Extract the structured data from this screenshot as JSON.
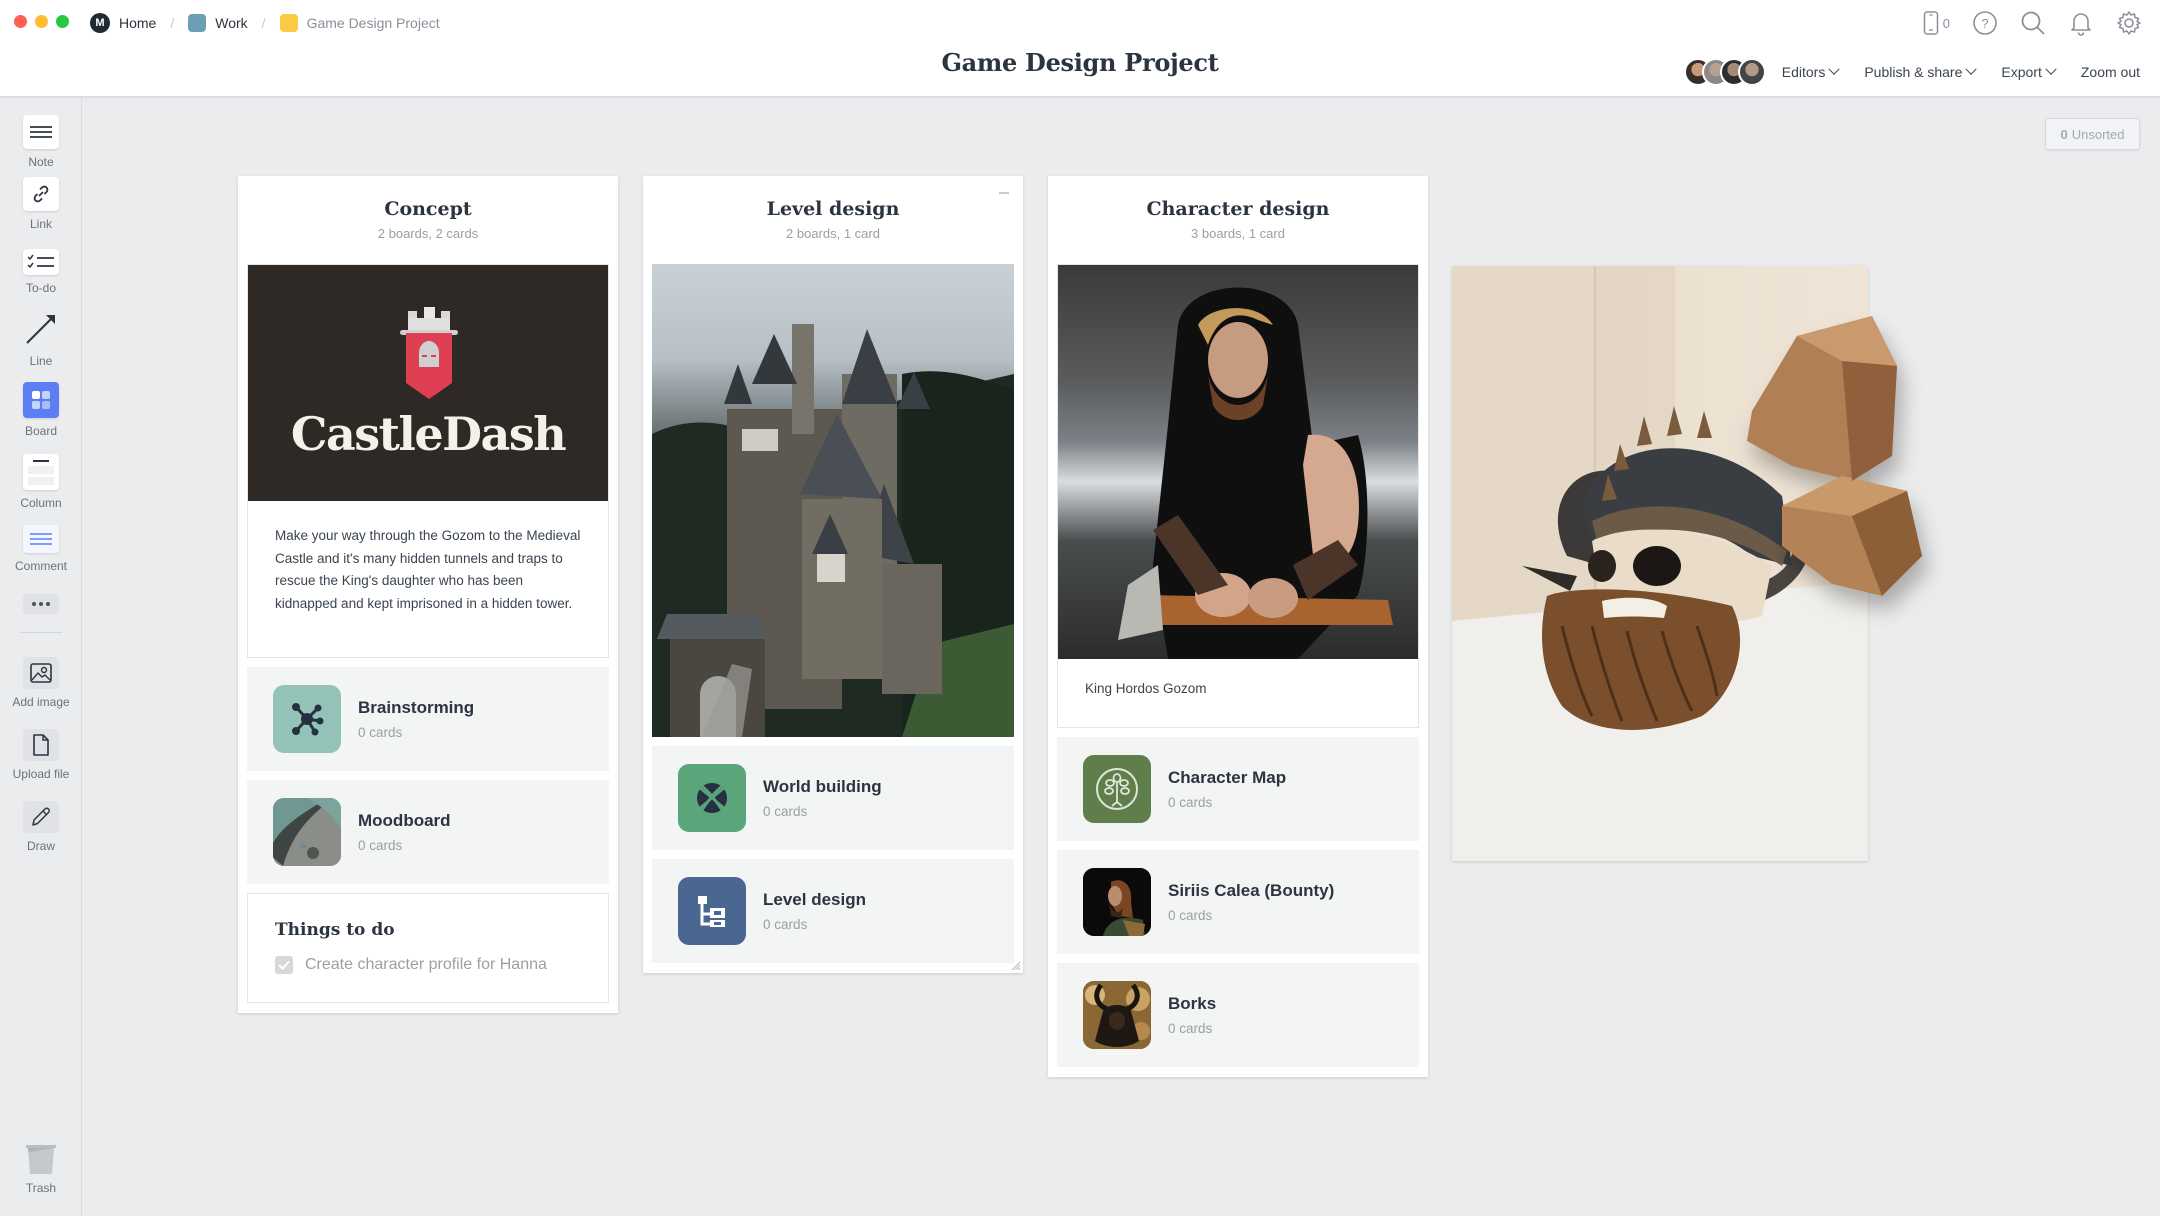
{
  "window": {
    "traffic_lights": {
      "close": "#fe5f57",
      "minimize": "#febc2e",
      "maximize": "#28c840"
    }
  },
  "breadcrumb": [
    {
      "label": "Home",
      "icon": "milanote-logo-icon",
      "color": "#1f2a33"
    },
    {
      "label": "Work",
      "icon": "board-color-icon",
      "color": "#6a9fb5"
    },
    {
      "label": "Game Design Project",
      "icon": "board-color-icon",
      "color": "#fbc944"
    }
  ],
  "header": {
    "title": "Game Design Project",
    "device_count": "0",
    "icons": [
      "mobile-device-icon",
      "help-icon",
      "search-icon",
      "notification-bell-icon",
      "settings-gear-icon"
    ],
    "editors_label": "Editors",
    "publish_label": "Publish & share",
    "export_label": "Export",
    "zoom_label": "Zoom out"
  },
  "sidebar": {
    "tools": [
      {
        "label": "Note",
        "icon": "note-icon"
      },
      {
        "label": "Link",
        "icon": "link-icon"
      },
      {
        "label": "To-do",
        "icon": "todo-list-icon"
      },
      {
        "label": "Line",
        "icon": "arrow-line-icon"
      },
      {
        "label": "Board",
        "icon": "board-icon"
      },
      {
        "label": "Column",
        "icon": "column-icon"
      },
      {
        "label": "Comment",
        "icon": "comment-icon"
      }
    ],
    "more_icon": "more-dots-icon",
    "uploads": [
      {
        "label": "Add image",
        "icon": "image-icon"
      },
      {
        "label": "Upload file",
        "icon": "file-icon"
      },
      {
        "label": "Draw",
        "icon": "pencil-icon"
      }
    ],
    "trash_label": "Trash"
  },
  "unsorted": {
    "count": "0",
    "label": "Unsorted"
  },
  "columns": [
    {
      "title": "Concept",
      "subtitle": "2 boards, 2 cards",
      "logo_text": "CastleDash",
      "note": "Make your way through the Gozom to the Medieval Castle and it's many hidden tunnels and traps to rescue the King's daughter who has been kidnapped and kept imprisoned in a hidden tower.",
      "boards": [
        {
          "name": "Brainstorming",
          "count": "0 cards",
          "icon_color": "#93c2b8"
        },
        {
          "name": "Moodboard",
          "count": "0 cards",
          "icon_color": "#6f9590"
        }
      ],
      "todo": {
        "title": "Things to do",
        "items": [
          {
            "text": "Create character profile for Hanna",
            "checked": true
          }
        ]
      }
    },
    {
      "title": "Level design",
      "subtitle": "2 boards, 1 card",
      "image_alt": "Gothic castle on a forested hillside",
      "boards": [
        {
          "name": "World building",
          "count": "0 cards",
          "icon_color": "#5aa57a"
        },
        {
          "name": "Level design",
          "count": "0 cards",
          "icon_color": "#4a6791"
        }
      ]
    },
    {
      "title": "Character design",
      "subtitle": "3 boards, 1 card",
      "image_alt": "Bearded warrior in fur holding an axe",
      "caption": "King Hordos Gozom",
      "boards": [
        {
          "name": "Character Map",
          "count": "0 cards",
          "icon_color": "#5f7e4c"
        },
        {
          "name": "Siriis Calea (Bounty)",
          "count": "0 cards",
          "icon_color": "#1a1410"
        },
        {
          "name": "Borks",
          "count": "0 cards",
          "icon_color": "#3b2a18"
        }
      ]
    }
  ],
  "free_image": {
    "alt": "Viking skull with horned helmet and floating rocks"
  }
}
